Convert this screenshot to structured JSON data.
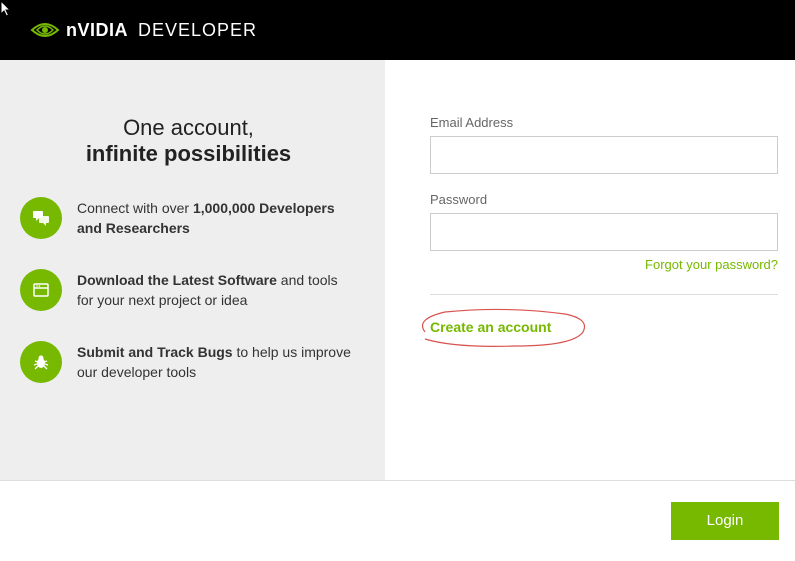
{
  "header": {
    "brand_prefix": "n",
    "brand_main": "VIDIA",
    "brand_sub": "DEVELOPER"
  },
  "tagline": {
    "line1": "One account,",
    "line2": "infinite possibilities"
  },
  "features": [
    {
      "pre": "Connect with over ",
      "bold": "1,000,000 Developers and Researchers",
      "post": ""
    },
    {
      "pre": "",
      "bold": "Download the Latest Software",
      "post": " and tools for your next project or idea"
    },
    {
      "pre": "",
      "bold": "Submit and Track Bugs",
      "post": " to help us improve our developer tools"
    }
  ],
  "form": {
    "email_label": "Email Address",
    "email_value": "",
    "password_label": "Password",
    "password_value": "",
    "forgot_link": "Forgot your password?",
    "create_link": "Create an account"
  },
  "footer": {
    "login_label": "Login"
  },
  "colors": {
    "accent": "#76b900"
  }
}
